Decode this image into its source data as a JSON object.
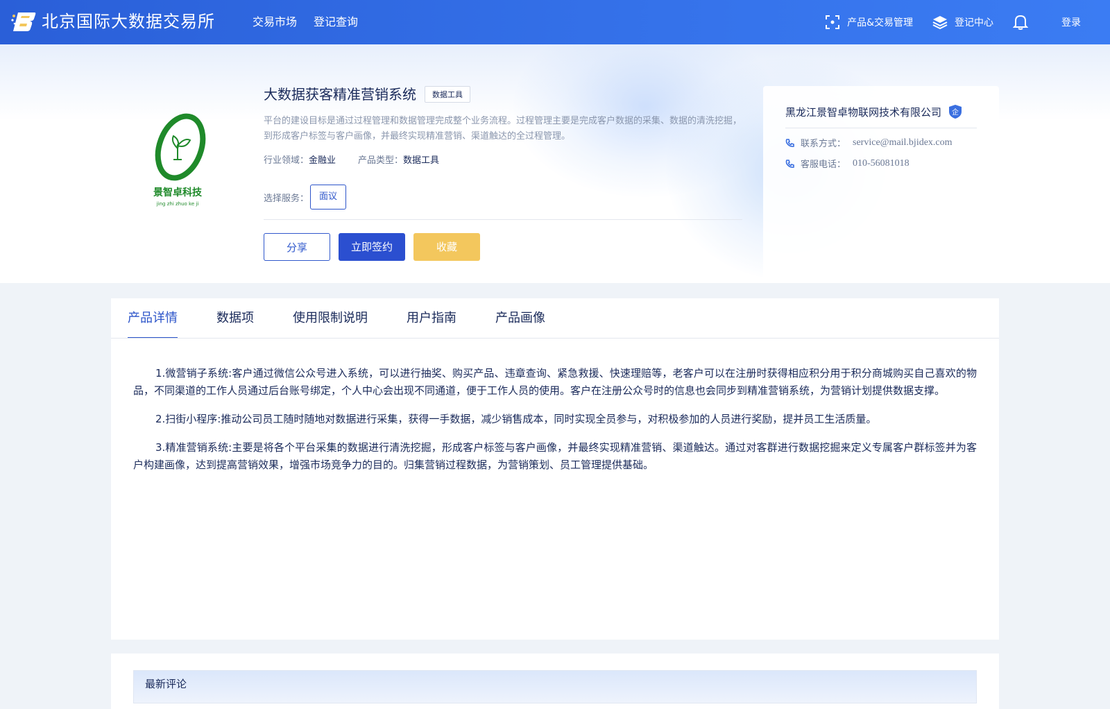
{
  "header": {
    "brand": "北京国际大数据交易所",
    "nav": [
      "交易市场",
      "登记查询"
    ],
    "product_trade_mgmt": "产品&交易管理",
    "registry_center": "登记中心",
    "login": "登录"
  },
  "product": {
    "title": "大数据获客精准营销系统",
    "tag": "数据工具",
    "logo_text": "景智卓科技",
    "logo_pinyin": "jing zhi zhuo ke ji",
    "description": "平台的建设目标是通过过程管理和数据管理完成整个业务流程。过程管理主要是完成客户数据的采集、数据的清洗挖掘，到形成客户标签与客户画像，并最终实现精准营销、渠道触达的全过程管理。",
    "industry_label": "行业领域：",
    "industry_value": "金融业",
    "type_label": "产品类型：",
    "type_value": "数据工具",
    "service_label": "选择服务：",
    "service_option": "面议",
    "buttons": {
      "share": "分享",
      "sign": "立即签约",
      "favorite": "收藏"
    }
  },
  "company": {
    "name": "黑龙江景智卓物联网技术有限公司",
    "badge": "企",
    "contact_label": "联系方式：",
    "contact_value": "service@mail.bjidex.com",
    "phone_label": "客服电话：",
    "phone_value": "010-56081018"
  },
  "tabs": [
    "产品详情",
    "数据项",
    "使用限制说明",
    "用户指南",
    "产品画像"
  ],
  "details": [
    "1.微营销子系统:客户通过微信公众号进入系统，可以进行抽奖、购买产品、违章查询、紧急救援、快速理赔等，老客户可以在注册时获得相应积分用于积分商城购买自己喜欢的物品，不同渠道的工作人员通过后台账号绑定，个人中心会出现不同通道，便于工作人员的使用。客户在注册公众号时的信息也会同步到精准营销系统，为营销计划提供数据支撑。",
    "2.扫街小程序:推动公司员工随时随地对数据进行采集，获得一手数据，减少销售成本，同时实现全员参与，对积极参加的人员进行奖励，提并员工生活质量。",
    "3.精准营销系统:主要是将各个平台采集的数据进行清洗挖掘，形成客户标签与客户画像，并最终实现精准营销、渠道触达。通过对客群进行数据挖掘来定义专属客户群标签并为客户构建画像，达到提高营销效果，增强市场竞争力的目的。归集营销过程数据，为营销策划、员工管理提供基础。"
  ],
  "comments": {
    "title": "最新评论"
  },
  "colors": {
    "header": "#3572ea",
    "primary": "#2b4fd0",
    "favorite": "#f3c75d",
    "logo_green": "#1f8a2a"
  }
}
